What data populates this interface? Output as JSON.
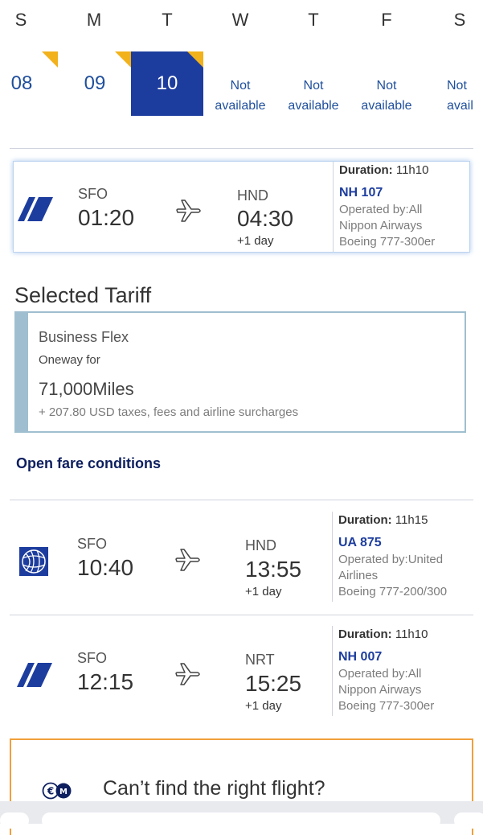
{
  "calendar": {
    "weekdays": [
      "S",
      "M",
      "T",
      "W",
      "T",
      "F",
      "S"
    ],
    "dates": [
      {
        "day": "08",
        "flag": true
      },
      {
        "day": "09",
        "flag": true
      },
      {
        "day": "10",
        "flag": true,
        "selected": true
      }
    ],
    "unavailable": [
      {
        "line1": "Not",
        "line2": "available"
      },
      {
        "line1": "Not",
        "line2": "available"
      },
      {
        "line1": "Not",
        "line2": "available"
      },
      {
        "line1": "Not",
        "line2": "avail"
      }
    ]
  },
  "selected_flight": {
    "airline": "ANA",
    "from": "SFO",
    "dep": "01:20",
    "to": "HND",
    "arr": "04:30",
    "plus": "+1 day",
    "duration_label": "Duration:",
    "duration": "11h10",
    "flight_no": "NH 107",
    "operated_line1": "Operated by:All",
    "operated_line2": "Nippon Airways",
    "aircraft": "Boeing 777-300er"
  },
  "tariff": {
    "section_title": "Selected Tariff",
    "name": "Business Flex",
    "subtitle": "Oneway for",
    "miles": "71,000Miles",
    "taxes": "+ 207.80 USD taxes, fees and airline surcharges",
    "link": "Open fare conditions"
  },
  "flights": [
    {
      "airline": "United",
      "from": "SFO",
      "dep": "10:40",
      "to": "HND",
      "arr": "13:55",
      "plus": "+1 day",
      "duration_label": "Duration:",
      "duration": "11h15",
      "flight_no": "UA 875",
      "operated_line1": "Operated by:United",
      "operated_line2": "Airlines",
      "aircraft": "Boeing 777-200/300"
    },
    {
      "airline": "ANA",
      "from": "SFO",
      "dep": "12:15",
      "to": "NRT",
      "arr": "15:25",
      "plus": "+1 day",
      "duration_label": "Duration:",
      "duration": "11h10",
      "flight_no": "NH 007",
      "operated_line1": "Operated by:All",
      "operated_line2": "Nippon Airways",
      "aircraft": "Boeing 777-300er"
    }
  ],
  "help": {
    "text": "Can’t find the right flight?",
    "icon": "euro-miles-icon"
  },
  "colors": {
    "brand_blue": "#1d3d9e",
    "flag_yellow": "#f2b21b",
    "tariff_border": "#9fbfd0",
    "help_border": "#f0a03a"
  }
}
